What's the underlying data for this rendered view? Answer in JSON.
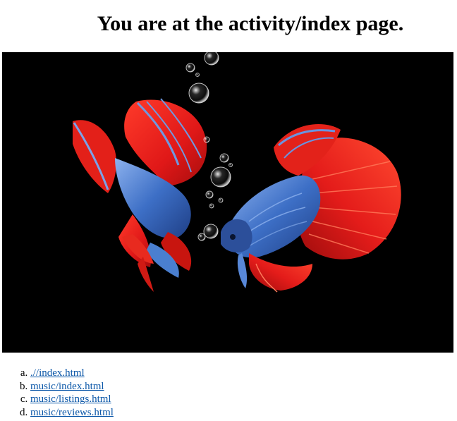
{
  "page": {
    "title": "You are at the activity/index page."
  },
  "hero_image": {
    "subject": "two betta fish with bubbles on black background",
    "colors": {
      "background": "#000000",
      "fin_red": "#e8201c",
      "fin_red_dark": "#b01010",
      "body_blue": "#3b6fc4",
      "body_blue_light": "#7fa8e8",
      "bubble": "#ffffff"
    }
  },
  "links": [
    {
      "label": ".//index.html",
      "href": ".//index.html"
    },
    {
      "label": "music/index.html",
      "href": "music/index.html"
    },
    {
      "label": "music/listings.html",
      "href": "music/listings.html"
    },
    {
      "label": "music/reviews.html",
      "href": "music/reviews.html"
    }
  ],
  "style": {
    "link_color": "#0b57a8"
  }
}
